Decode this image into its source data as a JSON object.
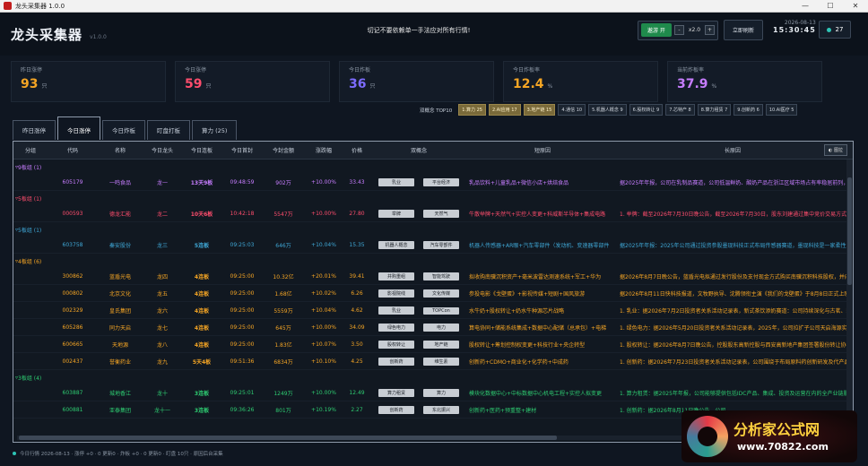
{
  "window": {
    "title": "龙头采集器 1.0.0",
    "minimize": "—",
    "maximize": "☐",
    "close": "✕"
  },
  "header": {
    "brand": "龙头采集器",
    "version": "v1.0.0",
    "banner": "切记不要依赖单一手法应对所有行情!"
  },
  "controls": {
    "replay_label": "遨游 开",
    "minus": "-",
    "speed": "x2.0",
    "plus": "+",
    "refresh_label": "立即刷新",
    "date": "2026-08-13",
    "time": "15:30:45",
    "count": "27"
  },
  "stats": [
    {
      "label": "昨日涨停",
      "value": "93",
      "unit": "只",
      "color": "#f5a524"
    },
    {
      "label": "今日涨停",
      "value": "59",
      "unit": "只",
      "color": "#ff4d6d"
    },
    {
      "label": "今日炸板",
      "value": "36",
      "unit": "只",
      "color": "#7c6cff"
    },
    {
      "label": "今日炸板率",
      "value": "12.4",
      "unit": "%",
      "color": "#f5a524"
    },
    {
      "label": "当前炸板率",
      "value": "37.9",
      "unit": "%",
      "color": "#c77dff"
    }
  ],
  "tagbar": {
    "label": "双概念 TOP10",
    "tags": [
      "1.算力 25",
      "2.AI应用 17",
      "3.地产链 15",
      "4.通信 10",
      "5.机器人概念 9",
      "6.股权转让 9",
      "7.芯特产 8",
      "8.算力租赁 7",
      "9.创新药 6",
      "10.AI医疗 5"
    ]
  },
  "tabs": [
    "昨日涨停",
    "今日涨停",
    "今日炸板",
    "盯盘打板",
    "算力 (25)"
  ],
  "table": {
    "chart_btn": "◐ 图拉",
    "headers": [
      "分组",
      "代码",
      "名称",
      "今日龙头",
      "今日连板",
      "今日首封",
      "今封金额",
      "涨跌幅",
      "价格",
      "双概念",
      "短原因",
      "长原因"
    ],
    "groups": [
      {
        "label": "9板组 (1)",
        "color": "#c77dff",
        "rows": [
          {
            "code": "605179",
            "name": "一鸣食品",
            "leader": "龙一",
            "boards": "13天9板",
            "first": "09:48:59",
            "amount": "902万",
            "pct": "+10.00%",
            "price": "33.43",
            "c1": "乳业",
            "c2": "平台经济",
            "short": "乳品饮料+儿童乳品+微信小店+烘焙食品",
            "long": "据2025年年报，公司在乳制品赛道，公司低温鲜奶、酸奶产品在浙江区域市场占有率稳居前列，学生饮用奶"
          }
        ]
      },
      {
        "label": "5板组 (1)",
        "color": "#ff4d6d",
        "rows": [
          {
            "code": "000593",
            "name": "德龙汇能",
            "leader": "龙二",
            "boards": "10天6板",
            "first": "10:42:18",
            "amount": "5547万",
            "pct": "+10.00%",
            "price": "27.80",
            "c1": "举牌",
            "c2": "天然气",
            "short": "牛散举牌+天然气+实控人变更+科威斯半导体+集成电路",
            "long": "1. 举牌：截至2026年7月30日晚公告，截至2026年7月30日，股东刘建通过集中竞价交易方式增持公司"
          }
        ]
      },
      {
        "label": "5板组 (1)",
        "color": "#3fa7d6",
        "rows": [
          {
            "code": "603758",
            "name": "秦安股份",
            "leader": "龙三",
            "boards": "5连板",
            "first": "09:25:03",
            "amount": "646万",
            "pct": "+10.04%",
            "price": "15.35",
            "c1": "机器人概念",
            "c2": "汽车零部件",
            "short": "机器人传感器+AR眼+汽车零部件（发动机、变速器零部件",
            "long": "据2025年年报：2025年公司通过投资参股墨现科技正式布局传感器赛道，墨现科技是一家柔性触觉类"
          }
        ]
      },
      {
        "label": "4板组 (6)",
        "color": "#f5a524",
        "rows": [
          {
            "code": "300862",
            "name": "蓝盾光电",
            "leader": "龙四",
            "boards": "4连板",
            "first": "09:25:00",
            "amount": "10.32亿",
            "pct": "+20.01%",
            "price": "39.41",
            "c1": "并购重组",
            "c2": "智能驾驶",
            "short": "拟收购南骥沉积资产+毫米波雷达测速系统+军工+华为",
            "long": "据2026年8月7日晚公告，蓝盾光电拟通过发行股份及支付现金方式购买南骥沉积科技股权，并向不超过3"
          },
          {
            "code": "000802",
            "name": "北京文化",
            "leader": "龙五",
            "boards": "4连板",
            "first": "09:25:00",
            "amount": "1.68亿",
            "pct": "+10.02%",
            "price": "6.26",
            "c1": "影视院线",
            "c2": "文化传媒",
            "short": "参投电影《戈壁蛋》+影视传媒+短剧+国风旅游",
            "long": "据2026年8月11日快科技报道，文牧野执导、沈腾领衔主演《我们的戈壁蛋》于8月8日正式上映，灯塔专业版"
          },
          {
            "code": "002329",
            "name": "皇氏集团",
            "leader": "龙六",
            "boards": "4连板",
            "first": "09:25:00",
            "amount": "5559万",
            "pct": "+10.04%",
            "price": "4.62",
            "c1": "乳业",
            "c2": "TOPCon",
            "short": "水牛奶+股权转让+奶水牛种源芯片战略",
            "long": "1. 乳业：据2026年7月2日投资者关系活动记录表，新式茶饮添奶赛道：公司持续深化与古茗、霸王茶姬"
          },
          {
            "code": "605286",
            "name": "同力天启",
            "leader": "龙七",
            "boards": "4连板",
            "first": "09:25:00",
            "amount": "645万",
            "pct": "+10.00%",
            "price": "34.09",
            "c1": "绿色电力",
            "c2": "电力",
            "short": "算电协同+储能系统集成+数据中心配储（总承包）+电梯",
            "long": "1. 绿色电力：据2026年5月20日投资者关系活动记录表，2025年，公司拉扩子公司天启海源实现净利润"
          },
          {
            "code": "600665",
            "name": "天地源",
            "leader": "龙八",
            "boards": "4连板",
            "first": "09:25:00",
            "amount": "1.83亿",
            "pct": "+10.07%",
            "price": "3.50",
            "c1": "股权转让",
            "c2": "地产链",
            "short": "股权转让+筹划控制权变更+科技行业+央企转型",
            "long": "1. 股权转让：据2026年8月7日晚公告，控股股东高新控股与西安高新地产集团签署股份转让协议，公司"
          },
          {
            "code": "002437",
            "name": "誉衡药业",
            "leader": "龙九",
            "boards": "5天4板",
            "first": "09:51:36",
            "amount": "6834万",
            "pct": "+10.10%",
            "price": "4.25",
            "c1": "创新药",
            "c2": "维生素",
            "short": "创新药+CDMO+商业化+化学药+中成药",
            "long": "1. 创新药：据2026年7月23日投资者关系活动记录表，公司围绕于布局原料药创新研发及代产品出海"
          }
        ]
      },
      {
        "label": "3板组 (4)",
        "color": "#2ecc71",
        "rows": [
          {
            "code": "603887",
            "name": "城地香江",
            "leader": "龙十",
            "boards": "3连板",
            "first": "09:25:01",
            "amount": "1249万",
            "pct": "+10.00%",
            "price": "12.49",
            "c1": "算力租赁",
            "c2": "算力",
            "short": "模块化数据中心+中标数据中心机电工程+实控人拟变更",
            "long": "1. 算力租赁：据2025年年报，公司能够提供包括IDC产品、集成、投资及运营在内的全产业链服务，属"
          },
          {
            "code": "600881",
            "name": "亚泰集团",
            "leader": "龙十一",
            "boards": "3连板",
            "first": "09:36:26",
            "amount": "801万",
            "pct": "+10.19%",
            "price": "2.27",
            "c1": "创新药",
            "c2": "东北振兴",
            "short": "创新药+医药+预重整+建材",
            "long": "1. 创新药：据2026年8月11日晚公告，公司"
          }
        ]
      }
    ]
  },
  "statusbar": {
    "text": "今日行情 2026-08-13 · 涨停 +0 · 0 更新0 · 炸板 +0 · 0 更新0 · 盯盘 10只 · 原因后台采集"
  },
  "watermark": {
    "title": "分析家公式网",
    "url": "www.70822.com"
  }
}
